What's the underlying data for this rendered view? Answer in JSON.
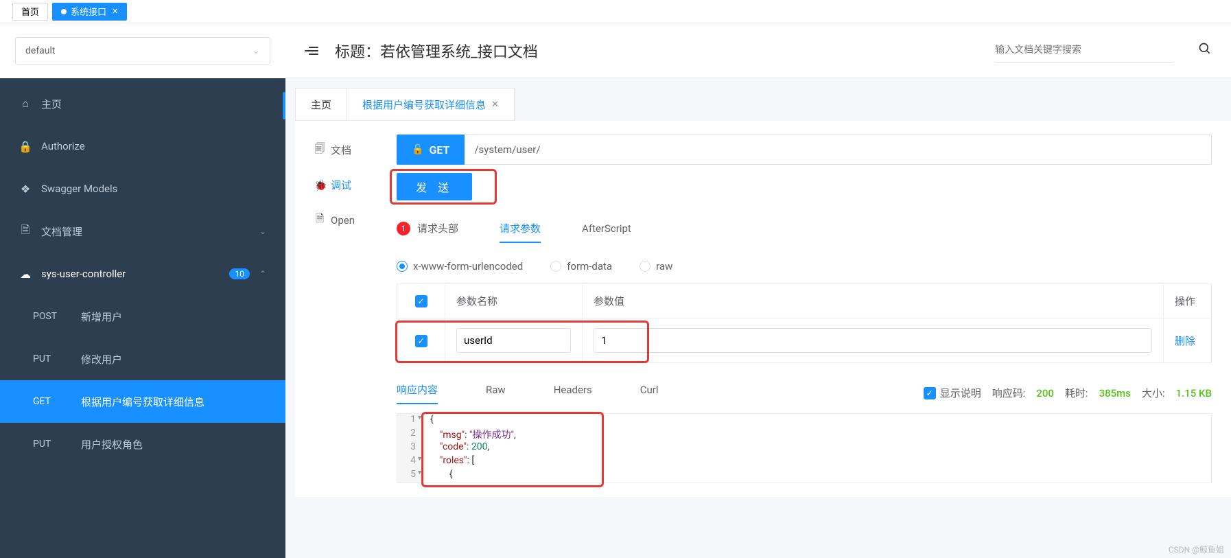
{
  "topTabs": {
    "home": "首页",
    "active": "系统接口"
  },
  "sidebar": {
    "select": "default",
    "items": [
      {
        "icon": "home",
        "label": "主页"
      },
      {
        "icon": "lock",
        "label": "Authorize"
      },
      {
        "icon": "cube",
        "label": "Swagger Models"
      },
      {
        "icon": "doc",
        "label": "文档管理"
      }
    ],
    "controller": {
      "label": "sys-user-controller",
      "badge": "10"
    },
    "endpoints": [
      {
        "method": "POST",
        "label": "新增用户"
      },
      {
        "method": "PUT",
        "label": "修改用户"
      },
      {
        "method": "GET",
        "label": "根据用户编号获取详细信息"
      },
      {
        "method": "PUT",
        "label": "用户授权角色"
      }
    ]
  },
  "header": {
    "title": "标题：若依管理系统_接口文档",
    "searchPlaceholder": "输入文档关键字搜索"
  },
  "docTabs": {
    "home": "主页",
    "active": "根据用户编号获取详细信息"
  },
  "leftTabs": {
    "doc": "文档",
    "debug": "调试",
    "open": "Open"
  },
  "request": {
    "method": "GET",
    "url": "/system/user/",
    "sendBtn": "发 送",
    "tabs": {
      "headers": "请求头部",
      "headersCount": "1",
      "params": "请求参数",
      "after": "AfterScript"
    },
    "encoding": {
      "urlencoded": "x-www-form-urlencoded",
      "formdata": "form-data",
      "raw": "raw"
    },
    "table": {
      "colName": "参数名称",
      "colValue": "参数值",
      "colAction": "操作",
      "row": {
        "name": "userId",
        "value": "1",
        "delete": "删除"
      }
    }
  },
  "response": {
    "tabs": {
      "content": "响应内容",
      "raw": "Raw",
      "headers": "Headers",
      "curl": "Curl"
    },
    "showDesc": "显示说明",
    "codeLabel": "响应码:",
    "codeVal": "200",
    "timeLabel": "耗时:",
    "timeVal": "385ms",
    "sizeLabel": "大小:",
    "sizeVal": "1.15 KB",
    "body": {
      "msg": "操作成功",
      "code": 200
    }
  },
  "watermark": "CSDN @鲸鱼姐"
}
